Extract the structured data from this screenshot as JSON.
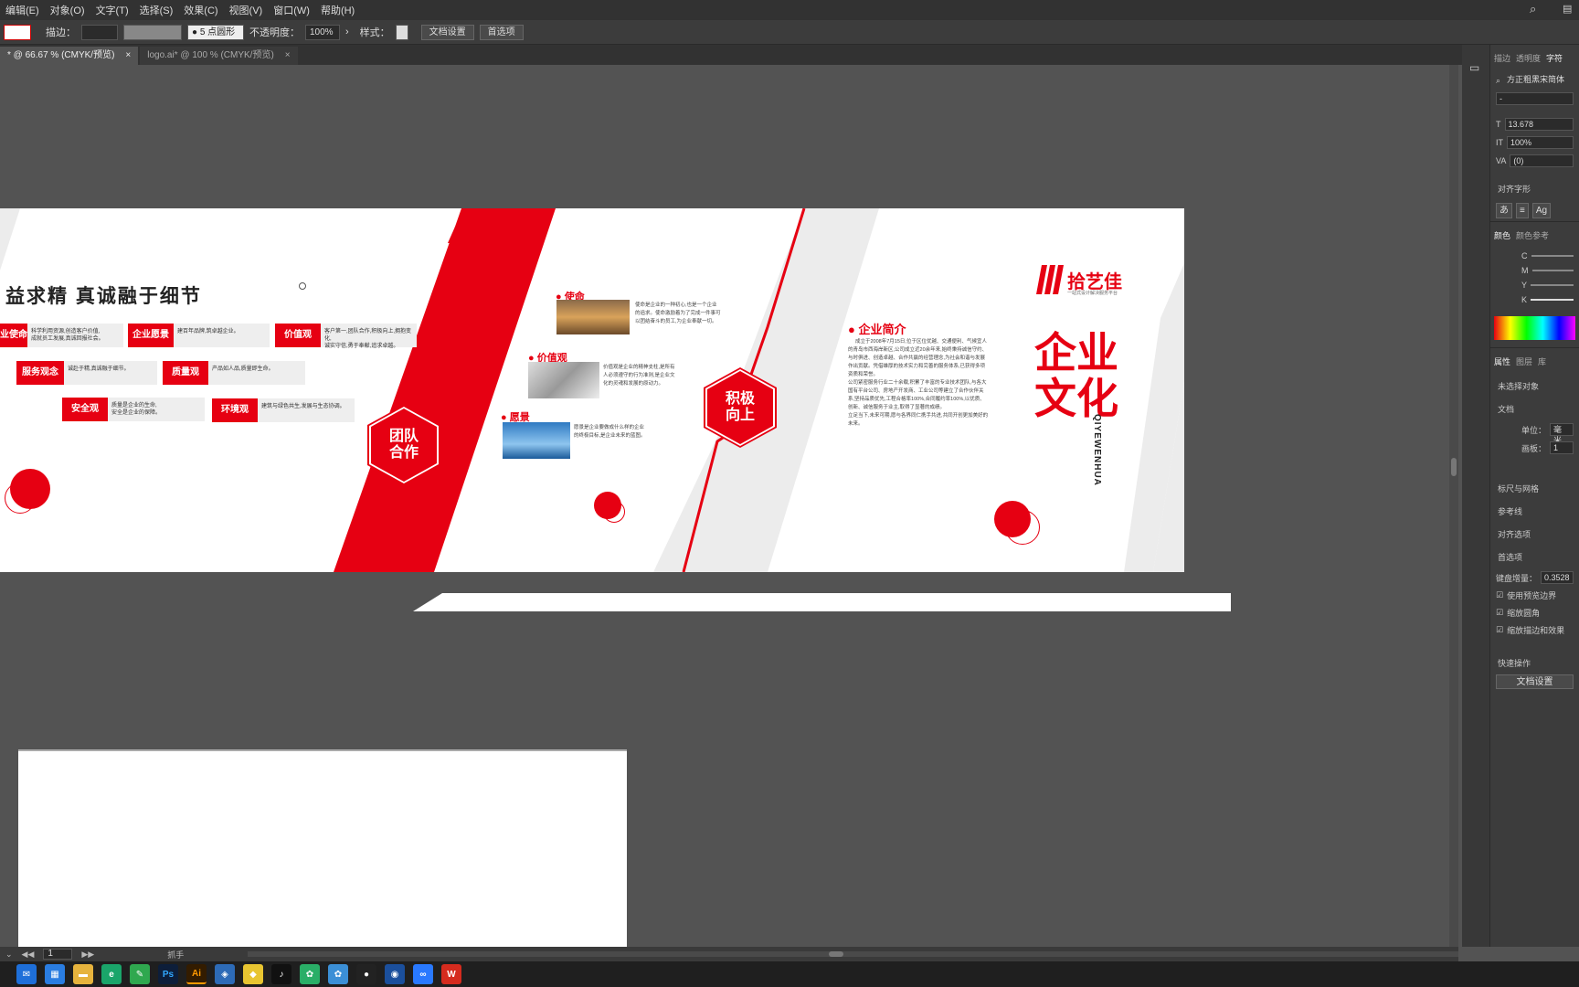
{
  "menu": [
    "编辑(E)",
    "对象(O)",
    "文字(T)",
    "选择(S)",
    "效果(C)",
    "视图(V)",
    "窗口(W)",
    "帮助(H)"
  ],
  "control": {
    "stroke_label": "描边：",
    "brush": "5 点圆形",
    "opacity_label": "不透明度：",
    "opacity_value": "100%",
    "style_label": "样式：",
    "doc_setup": "文档设置",
    "prefs": "首选项"
  },
  "tabs": [
    {
      "label": "* @ 66.67 % (CMYK/预览)",
      "close": "×"
    },
    {
      "label": "logo.ai* @ 100 % (CMYK/预览)",
      "close": "×"
    }
  ],
  "right_panel": {
    "tabs": [
      "描边",
      "透明度",
      "字符"
    ],
    "font": "方正粗黑宋简体",
    "font_style": "-",
    "font_size": "13.678",
    "scale": "100%",
    "tracking": "(0)",
    "align_glyph": "对齐字形",
    "color_tabs": [
      "颜色",
      "颜色参考"
    ],
    "cmyk": [
      "C",
      "M",
      "Y",
      "K"
    ],
    "props_tabs": [
      "属性",
      "图层",
      "库"
    ],
    "no_selection": "未选择对象",
    "doc": "文档",
    "unit_label": "单位：",
    "unit": "毫米",
    "artboard_label": "画板：",
    "artboard": "1",
    "rulers": "标尺与网格",
    "guides": "参考线",
    "align_opts": "对齐选项",
    "prefs": "首选项",
    "key_inc_label": "键盘增量：",
    "key_inc": "0.3528",
    "checks": [
      "使用预览边界",
      "缩放圆角",
      "缩放描边和效果"
    ],
    "quick": "快速操作",
    "doc_setup_btn": "文档设置"
  },
  "status": {
    "page": "1",
    "tool": "抓手"
  },
  "artwork": {
    "slogan": "益求精  真诚融于细节",
    "values": [
      {
        "label": "业使命",
        "desc": "科学利用资源,创造客户价值,\n成就员工发展,真诚回报社会。"
      },
      {
        "label": "企业愿景",
        "desc": "建百年品牌,筑卓越企业。"
      },
      {
        "label": "价值观",
        "desc": "客户第一,团队合作,积极向上,拥抱变化,\n诚实守信,勇于奉献,追求卓越。"
      },
      {
        "label": "服务观念",
        "desc": "诚赴于精,真诚融于细节。"
      },
      {
        "label": "质量观",
        "desc": "产品如人品,质量即生命。"
      },
      {
        "label": "安全观",
        "desc": "质量是企业的生命,\n安全是企业的保障。"
      },
      {
        "label": "环境观",
        "desc": "建筑与绿色共生,发展与生态协调。"
      }
    ],
    "hex1": "团队\n合作",
    "hex2": "积极\n向上",
    "mission_title": "使命",
    "mission_text": "使命是企业的一种初心,也是一个企业的追求。使命激励着为了完成一件事可以团结奋斗的员工,为企业奉献一切。",
    "values_title": "价值观",
    "values_text": "价值观是企业的精神支柱,是所有人必须遵守的行为准则,是企业文化的灵魂和发展的原动力。",
    "vision_title": "愿景",
    "vision_text": "愿景是企业要做成什么样的企业的终极目标,是企业未来的蓝图。",
    "intro_title": "企业简介",
    "intro_text": "成立于2008年7月15日,位于区位优越、交通便利、气候宜人的青岛市西海岸新区,公司成立近20余年来,始终秉持诚信守约、与时俱进、创造卓越、合作共赢的经营理念,为社会和谐与发展作出贡献。凭借雄厚的技术实力和完善的服务体系,已获得多项资质和荣誉。\n公司紧密服务行业二十余载,积累了丰富的专业技术团队,与各大国有平台公司、房地产开发商、工业公司等建立了合作伙伴关系,坚持品质优先,工程合格率100%,合同履约率100%,以优质、创新、诚信服务于业主,取得了显著的成绩。\n立足当下,未来可期,愿与各界同仁携手共进,共同开创更加美好的未来。",
    "brand_name": "拾艺佳",
    "brand_sub": "一站式设计解决服务平台",
    "culture_title": "企业文化",
    "culture_pinyin": "QIYEWENHUA"
  }
}
